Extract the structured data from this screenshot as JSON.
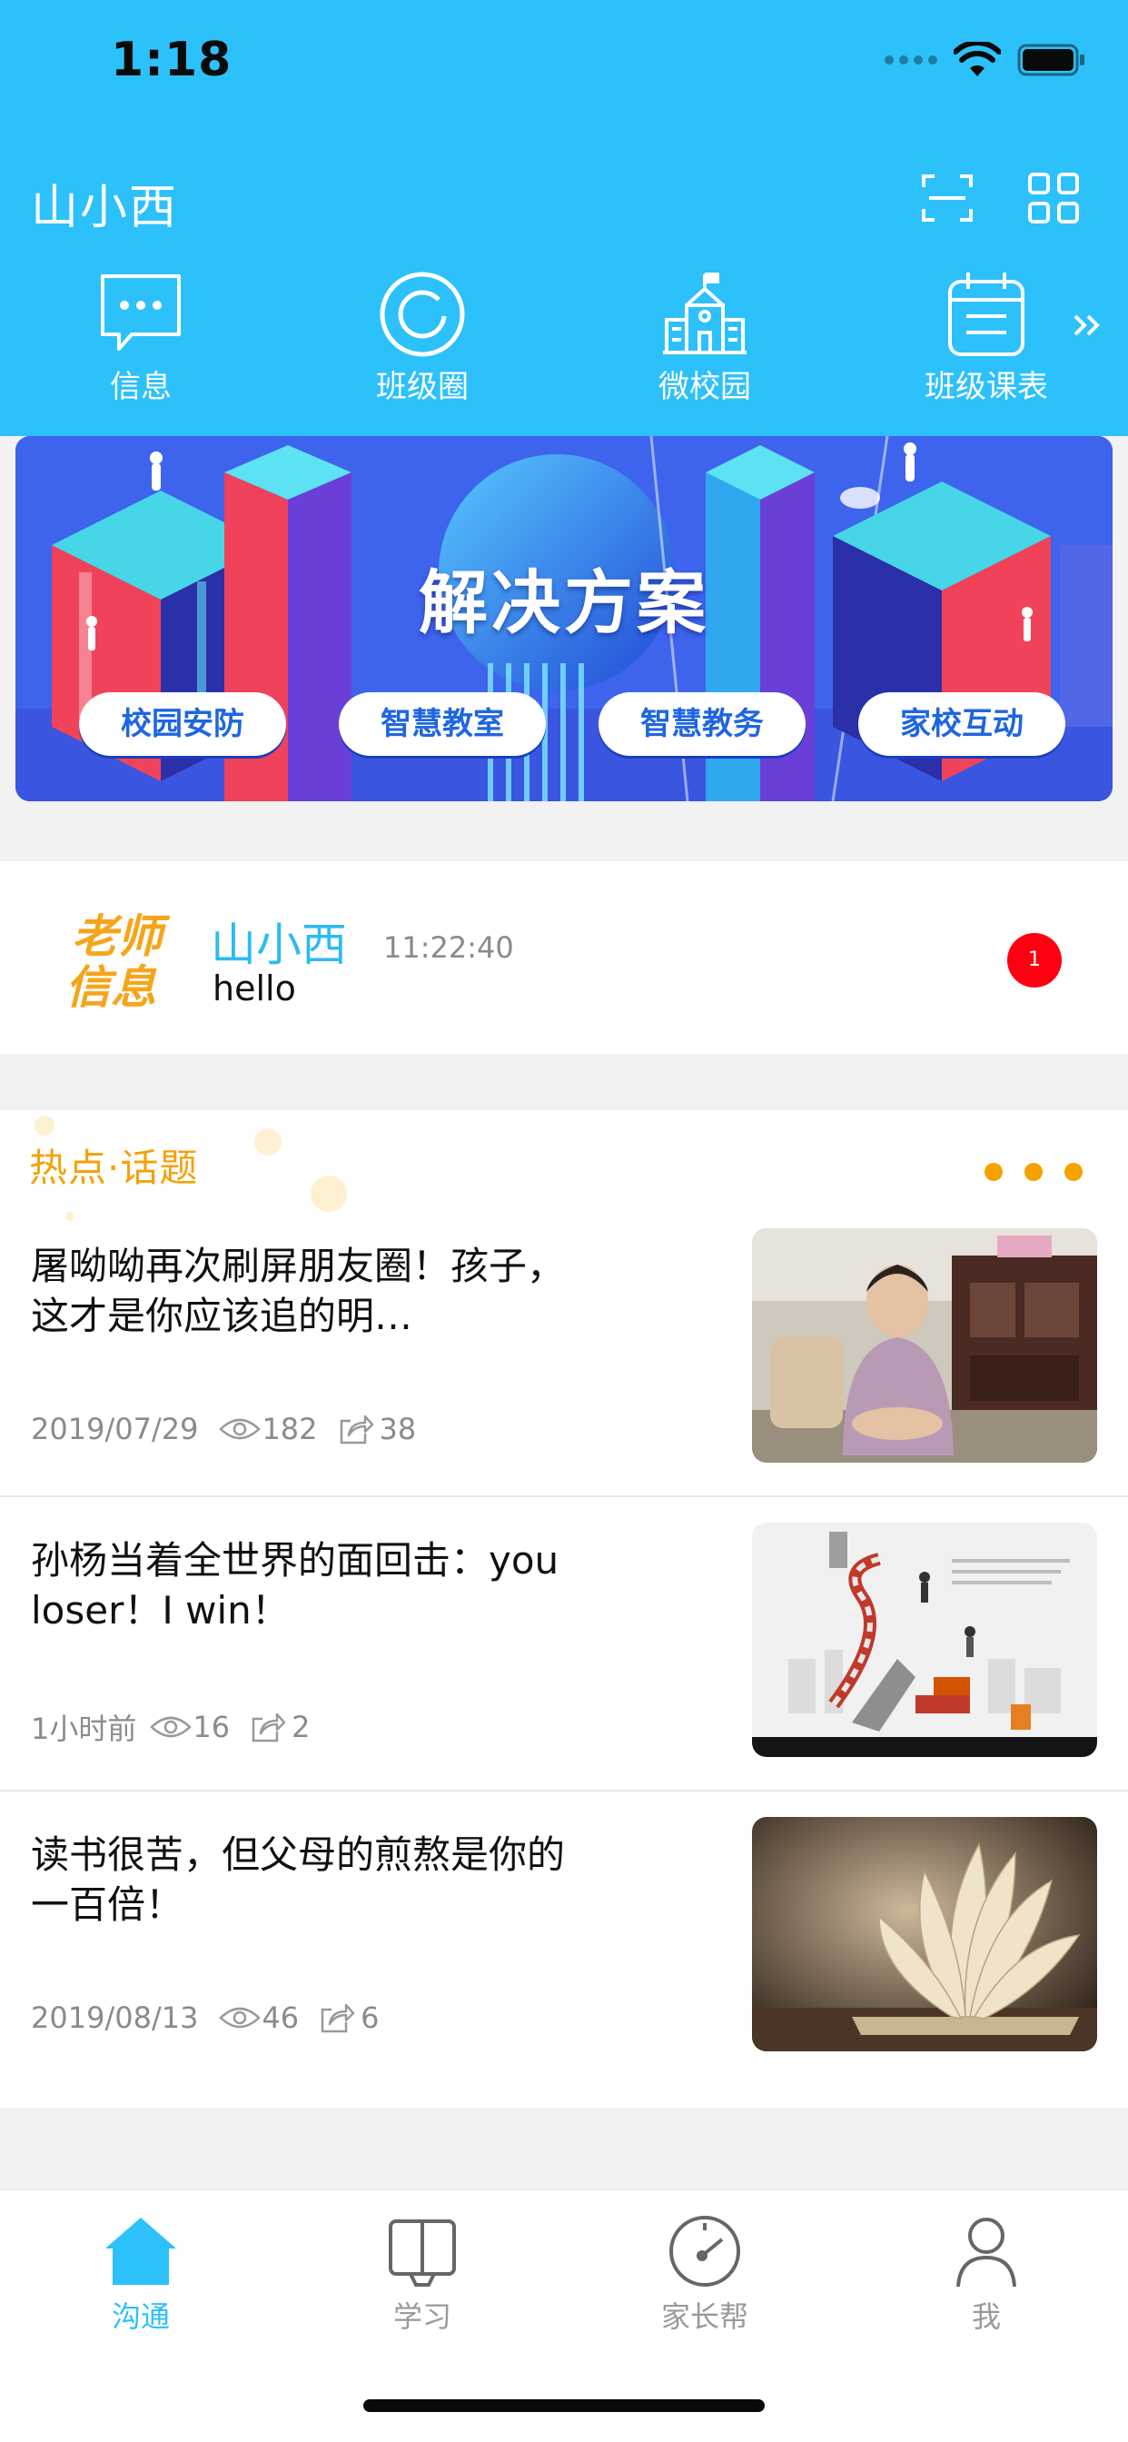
{
  "status_bar": {
    "time": "1:18"
  },
  "header": {
    "title": "山小西",
    "quick_links": [
      {
        "label": "信息",
        "icon": "message-icon"
      },
      {
        "label": "班级圈",
        "icon": "class-circle-icon"
      },
      {
        "label": "微校园",
        "icon": "school-icon"
      },
      {
        "label": "班级课表",
        "icon": "calendar-icon"
      }
    ]
  },
  "banner": {
    "title": "解决方案",
    "pills": [
      "校园安防",
      "智慧教室",
      "智慧教务",
      "家校互动"
    ]
  },
  "teacher_message": {
    "logo_text_line1": "老师",
    "logo_text_line2": "信息",
    "sender": "山小西",
    "time": "11:22:40",
    "text": "hello",
    "unread": "1"
  },
  "topics": {
    "title": "热点·话题",
    "articles": [
      {
        "title": "屠呦呦再次刷屏朋友圈！孩子，这才是你应该追的明…",
        "date": "2019/07/29",
        "views": "182",
        "shares": "38"
      },
      {
        "title": "孙杨当着全世界的面回击：you loser！I win！",
        "date": "1小时前",
        "views": "16",
        "shares": "2"
      },
      {
        "title": "读书很苦，但父母的煎熬是你的一百倍！",
        "date": "2019/08/13",
        "views": "46",
        "shares": "6"
      }
    ]
  },
  "tabbar": {
    "tabs": [
      {
        "label": "沟通",
        "active": true
      },
      {
        "label": "学习",
        "active": false
      },
      {
        "label": "家长帮",
        "active": false
      },
      {
        "label": "我",
        "active": false
      }
    ]
  },
  "colors": {
    "primary": "#2dc1fb",
    "accent_orange": "#f4a20a",
    "badge_red": "#ff0010"
  }
}
